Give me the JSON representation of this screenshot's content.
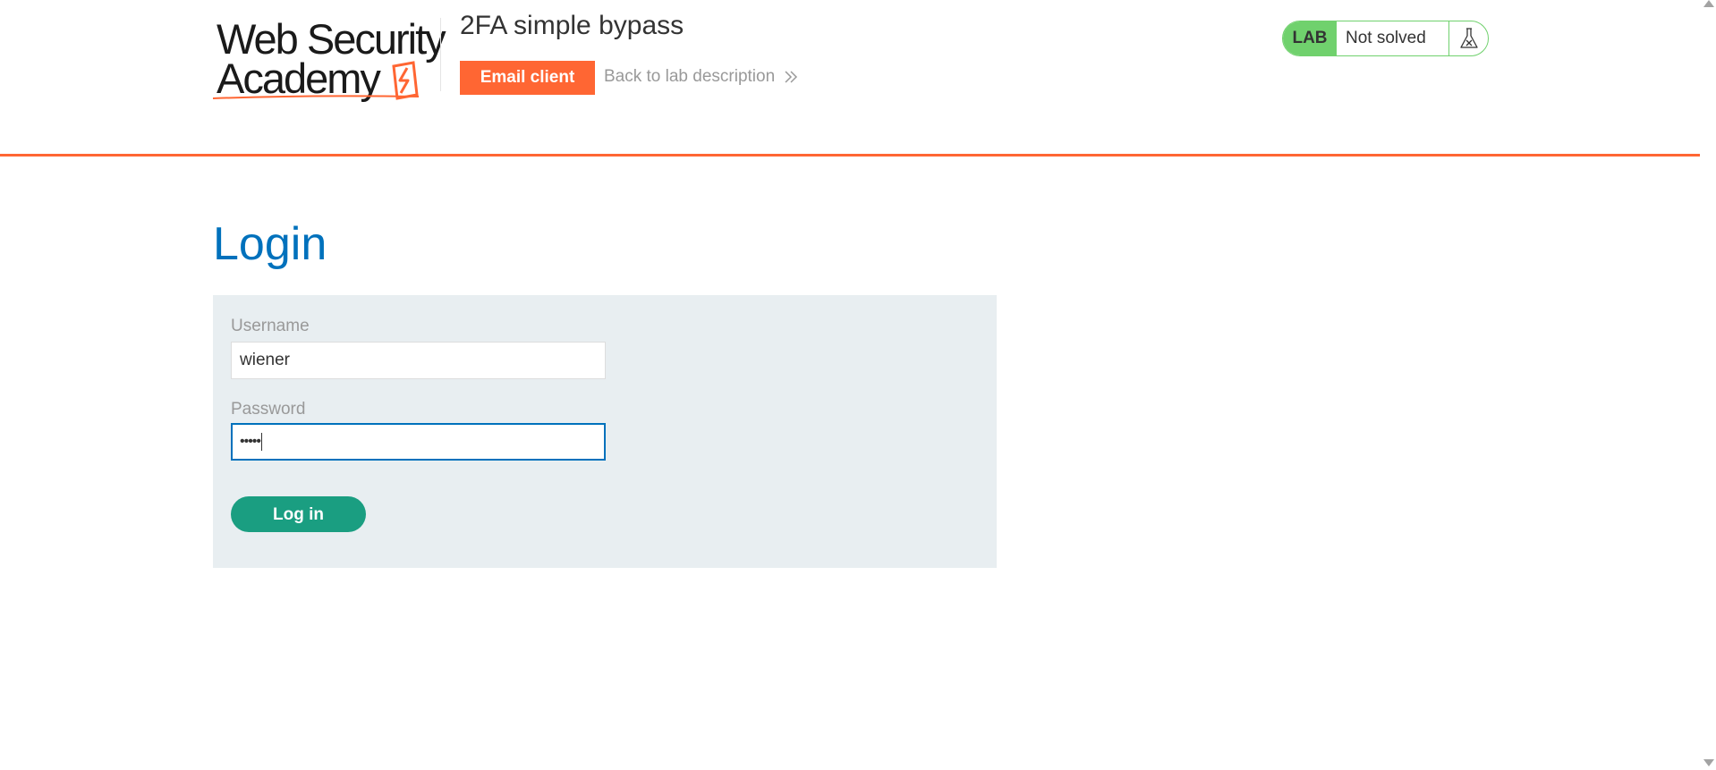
{
  "brand": {
    "line1": "Web Security",
    "line2": "Academy",
    "accent_color": "#ff6633"
  },
  "header": {
    "lab_title": "2FA simple bypass",
    "email_client_label": "Email client",
    "back_link_label": "Back to lab description",
    "back_link_icon": "double-chevron-right-icon",
    "lab_badge": "LAB",
    "lab_status": "Not solved",
    "status_icon": "flask-icon",
    "status_color": "#70d16d"
  },
  "main": {
    "title": "Login",
    "title_color": "#0071bc",
    "form": {
      "username_label": "Username",
      "username_value": "wiener",
      "password_label": "Password",
      "password_masked": "•••••",
      "submit_label": "Log in",
      "submit_color": "#1a9e81"
    }
  }
}
